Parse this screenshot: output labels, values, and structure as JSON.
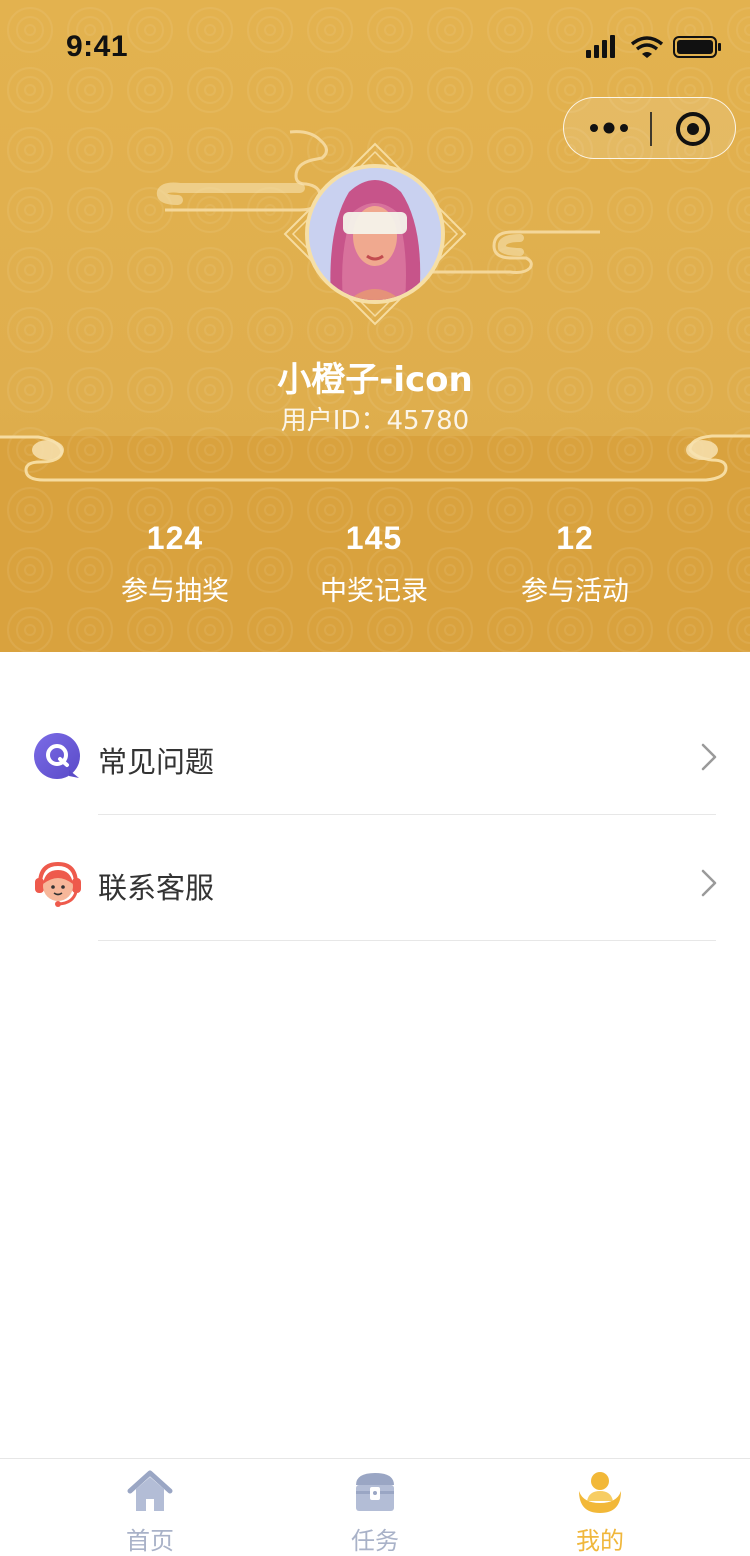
{
  "status_bar": {
    "time": "9:41"
  },
  "profile": {
    "name": "小橙子-icon",
    "user_id_label": "用户ID：",
    "user_id": "45780"
  },
  "stats": [
    {
      "value": "124",
      "label": "参与抽奖"
    },
    {
      "value": "145",
      "label": "中奖记录"
    },
    {
      "value": "12",
      "label": "参与活动"
    }
  ],
  "menu": [
    {
      "label": "常见问题",
      "icon": "faq-q-icon"
    },
    {
      "label": "联系客服",
      "icon": "customer-service-icon"
    }
  ],
  "tabbar": {
    "items": [
      {
        "label": "首页",
        "icon": "home-icon",
        "active": false
      },
      {
        "label": "任务",
        "icon": "treasure-chest-icon",
        "active": false
      },
      {
        "label": "我的",
        "icon": "user-icon",
        "active": true
      }
    ]
  },
  "colors": {
    "header_gold": "#e3b24f",
    "header_gold_dark": "#d9a23e",
    "tab_active": "#f0b73c",
    "tab_inactive": "#a9b2c8",
    "faq_purple": "#6a5bd6",
    "service_red": "#ee5a4c"
  }
}
